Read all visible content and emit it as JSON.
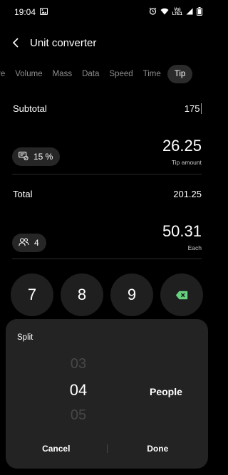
{
  "status": {
    "time": "19:04",
    "lte_top": "Vo)",
    "lte_bottom": "LTE1",
    "image_icon": "image-icon",
    "alarm_icon": "alarm-icon",
    "wifi_icon": "wifi-icon",
    "signal_icon": "signal-icon",
    "battery_icon": "battery-icon"
  },
  "header": {
    "title": "Unit converter"
  },
  "tabs": [
    "re",
    "Volume",
    "Mass",
    "Data",
    "Speed",
    "Time",
    "Tip"
  ],
  "active_tab": "Tip",
  "subtotal": {
    "label": "Subtotal",
    "value": "175"
  },
  "tip": {
    "percent": "15 %",
    "amount": "26.25",
    "caption": "Tip amount"
  },
  "total": {
    "label": "Total",
    "value": "201.25"
  },
  "split": {
    "people": "4",
    "each": "50.31",
    "caption": "Each"
  },
  "keypad": {
    "k7": "7",
    "k8": "8",
    "k9": "9"
  },
  "sheet": {
    "title": "Split",
    "prev": "03",
    "selected": "04",
    "next": "05",
    "unit": "People",
    "cancel": "Cancel",
    "done": "Done"
  },
  "colors": {
    "background": "#000000",
    "surface": "#232323",
    "cursor": "#4fd07b",
    "backspace": "#66d17f"
  }
}
